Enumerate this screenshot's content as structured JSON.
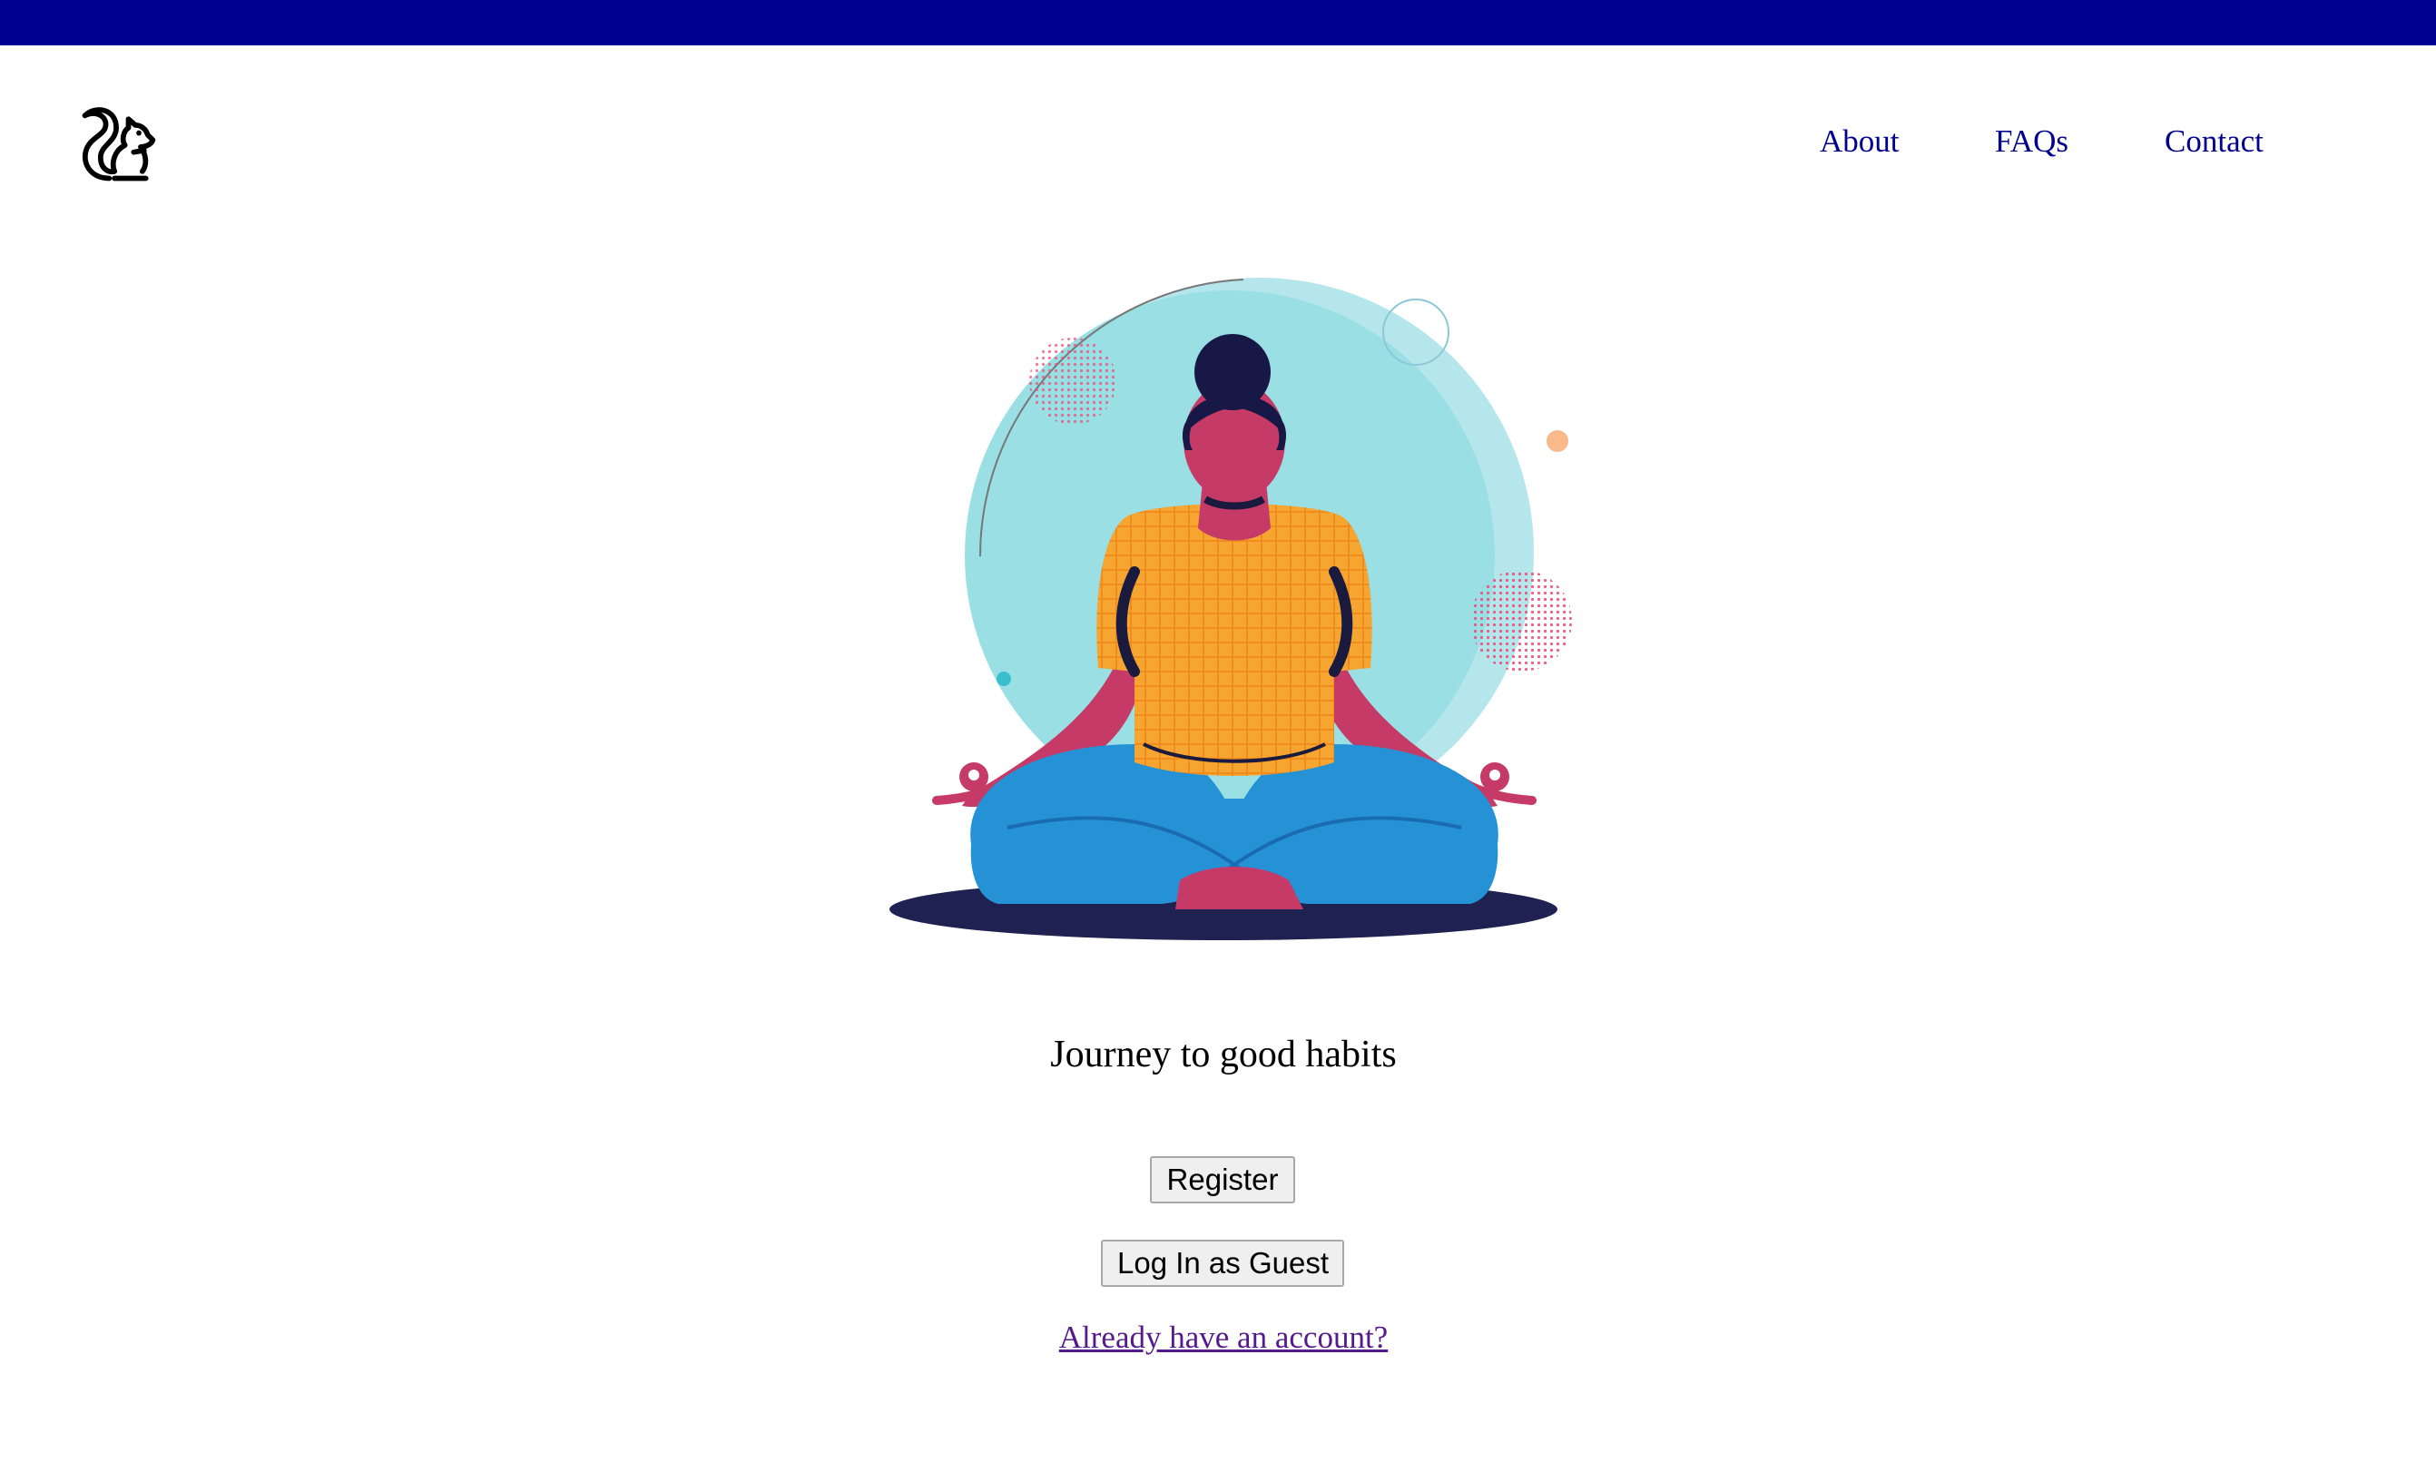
{
  "header": {
    "logo_icon": "squirrel-icon",
    "nav": [
      {
        "label": "About"
      },
      {
        "label": "FAQs"
      },
      {
        "label": "Contact"
      }
    ],
    "top_bar_color": "#000090",
    "nav_color": "#000090"
  },
  "hero": {
    "illustration": "meditating-woman-illustration",
    "tagline": "Journey to good habits"
  },
  "actions": {
    "register_label": "Register",
    "guest_label": "Log In as Guest",
    "login_link": "Already have an account?"
  }
}
